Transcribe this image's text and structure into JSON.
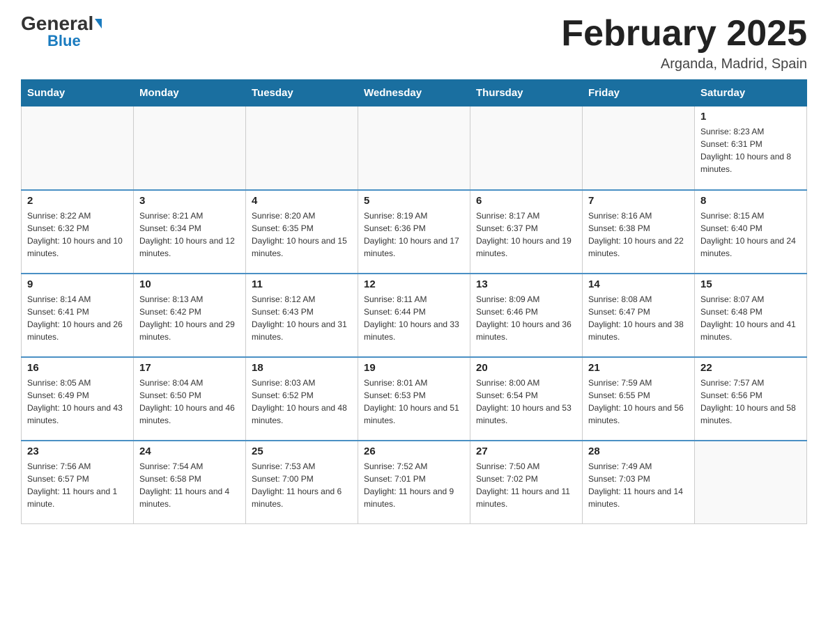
{
  "header": {
    "logo_general": "General",
    "logo_blue": "Blue",
    "title": "February 2025",
    "subtitle": "Arganda, Madrid, Spain"
  },
  "days_of_week": [
    "Sunday",
    "Monday",
    "Tuesday",
    "Wednesday",
    "Thursday",
    "Friday",
    "Saturday"
  ],
  "weeks": [
    [
      {
        "day": "",
        "info": ""
      },
      {
        "day": "",
        "info": ""
      },
      {
        "day": "",
        "info": ""
      },
      {
        "day": "",
        "info": ""
      },
      {
        "day": "",
        "info": ""
      },
      {
        "day": "",
        "info": ""
      },
      {
        "day": "1",
        "info": "Sunrise: 8:23 AM\nSunset: 6:31 PM\nDaylight: 10 hours and 8 minutes."
      }
    ],
    [
      {
        "day": "2",
        "info": "Sunrise: 8:22 AM\nSunset: 6:32 PM\nDaylight: 10 hours and 10 minutes."
      },
      {
        "day": "3",
        "info": "Sunrise: 8:21 AM\nSunset: 6:34 PM\nDaylight: 10 hours and 12 minutes."
      },
      {
        "day": "4",
        "info": "Sunrise: 8:20 AM\nSunset: 6:35 PM\nDaylight: 10 hours and 15 minutes."
      },
      {
        "day": "5",
        "info": "Sunrise: 8:19 AM\nSunset: 6:36 PM\nDaylight: 10 hours and 17 minutes."
      },
      {
        "day": "6",
        "info": "Sunrise: 8:17 AM\nSunset: 6:37 PM\nDaylight: 10 hours and 19 minutes."
      },
      {
        "day": "7",
        "info": "Sunrise: 8:16 AM\nSunset: 6:38 PM\nDaylight: 10 hours and 22 minutes."
      },
      {
        "day": "8",
        "info": "Sunrise: 8:15 AM\nSunset: 6:40 PM\nDaylight: 10 hours and 24 minutes."
      }
    ],
    [
      {
        "day": "9",
        "info": "Sunrise: 8:14 AM\nSunset: 6:41 PM\nDaylight: 10 hours and 26 minutes."
      },
      {
        "day": "10",
        "info": "Sunrise: 8:13 AM\nSunset: 6:42 PM\nDaylight: 10 hours and 29 minutes."
      },
      {
        "day": "11",
        "info": "Sunrise: 8:12 AM\nSunset: 6:43 PM\nDaylight: 10 hours and 31 minutes."
      },
      {
        "day": "12",
        "info": "Sunrise: 8:11 AM\nSunset: 6:44 PM\nDaylight: 10 hours and 33 minutes."
      },
      {
        "day": "13",
        "info": "Sunrise: 8:09 AM\nSunset: 6:46 PM\nDaylight: 10 hours and 36 minutes."
      },
      {
        "day": "14",
        "info": "Sunrise: 8:08 AM\nSunset: 6:47 PM\nDaylight: 10 hours and 38 minutes."
      },
      {
        "day": "15",
        "info": "Sunrise: 8:07 AM\nSunset: 6:48 PM\nDaylight: 10 hours and 41 minutes."
      }
    ],
    [
      {
        "day": "16",
        "info": "Sunrise: 8:05 AM\nSunset: 6:49 PM\nDaylight: 10 hours and 43 minutes."
      },
      {
        "day": "17",
        "info": "Sunrise: 8:04 AM\nSunset: 6:50 PM\nDaylight: 10 hours and 46 minutes."
      },
      {
        "day": "18",
        "info": "Sunrise: 8:03 AM\nSunset: 6:52 PM\nDaylight: 10 hours and 48 minutes."
      },
      {
        "day": "19",
        "info": "Sunrise: 8:01 AM\nSunset: 6:53 PM\nDaylight: 10 hours and 51 minutes."
      },
      {
        "day": "20",
        "info": "Sunrise: 8:00 AM\nSunset: 6:54 PM\nDaylight: 10 hours and 53 minutes."
      },
      {
        "day": "21",
        "info": "Sunrise: 7:59 AM\nSunset: 6:55 PM\nDaylight: 10 hours and 56 minutes."
      },
      {
        "day": "22",
        "info": "Sunrise: 7:57 AM\nSunset: 6:56 PM\nDaylight: 10 hours and 58 minutes."
      }
    ],
    [
      {
        "day": "23",
        "info": "Sunrise: 7:56 AM\nSunset: 6:57 PM\nDaylight: 11 hours and 1 minute."
      },
      {
        "day": "24",
        "info": "Sunrise: 7:54 AM\nSunset: 6:58 PM\nDaylight: 11 hours and 4 minutes."
      },
      {
        "day": "25",
        "info": "Sunrise: 7:53 AM\nSunset: 7:00 PM\nDaylight: 11 hours and 6 minutes."
      },
      {
        "day": "26",
        "info": "Sunrise: 7:52 AM\nSunset: 7:01 PM\nDaylight: 11 hours and 9 minutes."
      },
      {
        "day": "27",
        "info": "Sunrise: 7:50 AM\nSunset: 7:02 PM\nDaylight: 11 hours and 11 minutes."
      },
      {
        "day": "28",
        "info": "Sunrise: 7:49 AM\nSunset: 7:03 PM\nDaylight: 11 hours and 14 minutes."
      },
      {
        "day": "",
        "info": ""
      }
    ]
  ]
}
